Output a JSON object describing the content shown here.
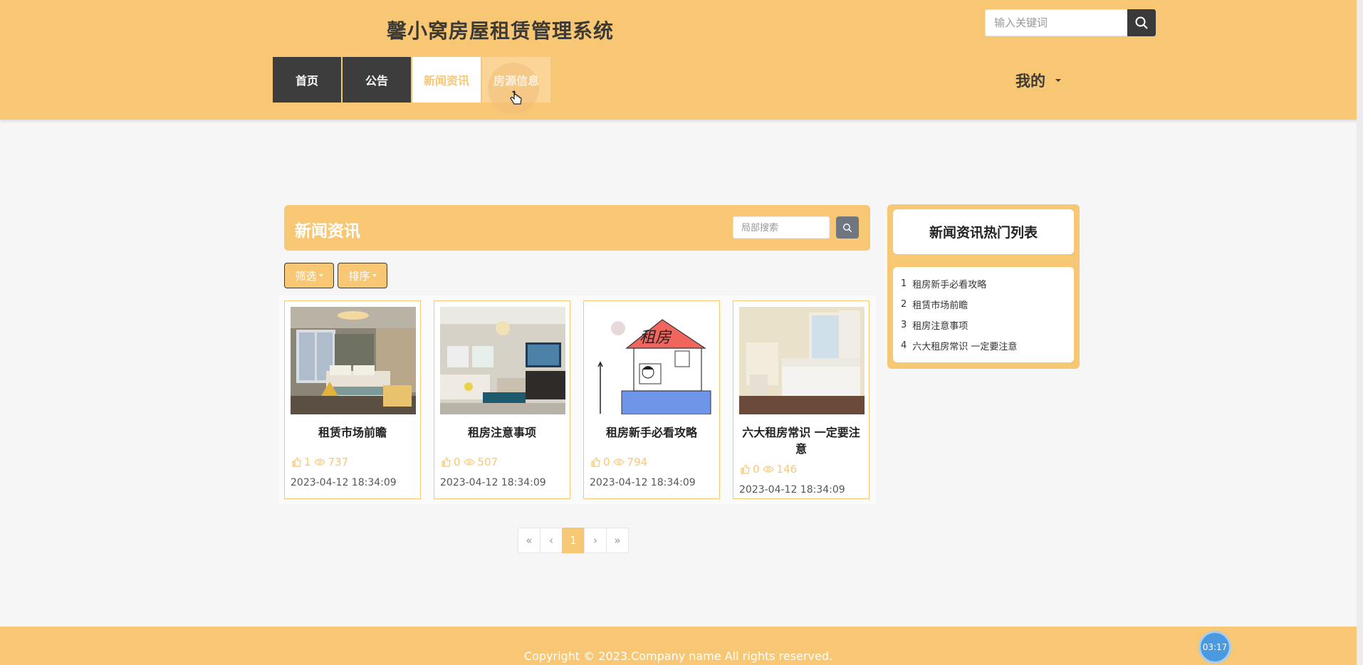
{
  "header": {
    "site_title": "馨小窝房屋租赁管理系统",
    "search_placeholder": "输入关键词",
    "nav": [
      "首页",
      "公告",
      "新闻资讯",
      "房源信息"
    ],
    "active_nav": "新闻资讯",
    "my_menu": "我的"
  },
  "news": {
    "title": "新闻资讯",
    "local_search_placeholder": "局部搜索",
    "filter_label": "筛选",
    "sort_label": "排序",
    "cards": [
      {
        "title": "租赁市场前瞻",
        "likes": "1",
        "views": "737",
        "date": "2023-04-12 18:34:09"
      },
      {
        "title": "租房注意事项",
        "likes": "0",
        "views": "507",
        "date": "2023-04-12 18:34:09"
      },
      {
        "title": "租房新手必看攻略",
        "likes": "0",
        "views": "794",
        "date": "2023-04-12 18:34:09",
        "image_text": "租房"
      },
      {
        "title": "六大租房常识 一定要注意",
        "likes": "0",
        "views": "146",
        "date": "2023-04-12 18:34:09"
      }
    ]
  },
  "pagination": {
    "first": "«",
    "prev": "‹",
    "current": "1",
    "next": "›",
    "last": "»"
  },
  "hot": {
    "title": "新闻资讯热门列表",
    "items": [
      {
        "rank": "1",
        "label": "租房新手必看攻略"
      },
      {
        "rank": "2",
        "label": "租赁市场前瞻"
      },
      {
        "rank": "3",
        "label": "租房注意事项"
      },
      {
        "rank": "4",
        "label": "六大租房常识 一定要注意"
      }
    ]
  },
  "footer": {
    "copyright": "Copyright © 2023.Company name All rights reserved."
  },
  "timer": "03:17",
  "colors": {
    "brand": "#f8c774",
    "dark": "#3d3d3d"
  }
}
